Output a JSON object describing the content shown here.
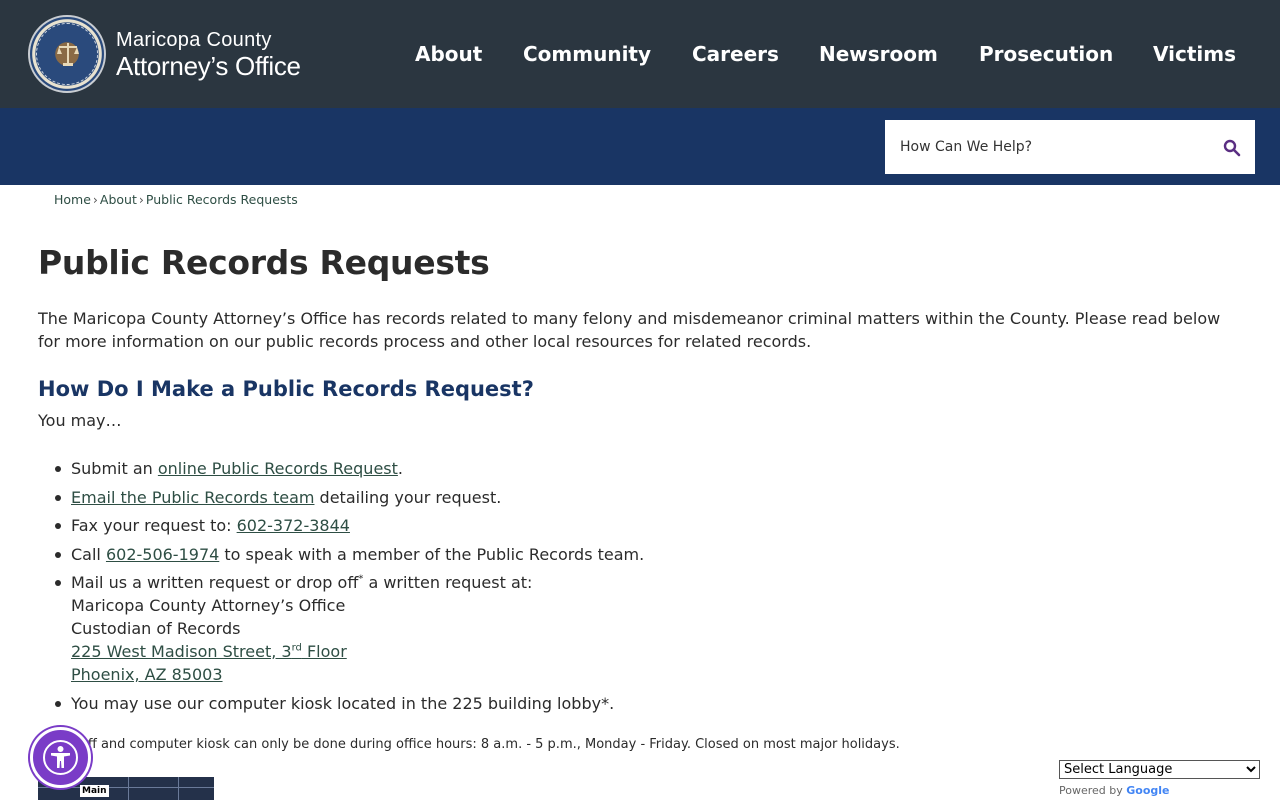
{
  "header": {
    "logo_line1": "Maricopa County",
    "logo_line2": "Attorney’s Office",
    "nav": [
      "About",
      "Community",
      "Careers",
      "Newsroom",
      "Prosecution",
      "Victims"
    ]
  },
  "search": {
    "placeholder": "How Can We Help?"
  },
  "breadcrumb": {
    "home": "Home",
    "about": "About",
    "current": "Public Records Requests",
    "sep": "›"
  },
  "page": {
    "title": "Public Records Requests",
    "intro": "The Maricopa County Attorney’s Office has records related to many felony and misdemeanor criminal matters within the County. Please read below for more information on our public records process and other local resources for related records.",
    "section_title": "How Do I Make a Public Records Request?",
    "you_may": "You may…",
    "steps": {
      "submit_pre": "Submit an ",
      "submit_link": "online Public Records Request",
      "submit_post": ".",
      "email_link": "Email the Public Records team",
      "email_post": " detailing your request.",
      "fax_pre": "Fax your request to: ",
      "fax_link": "602-372-3844",
      "call_pre": "Call ",
      "call_link": "602-506-1974",
      "call_post": " to speak with a member of the Public Records team.",
      "mail_pre": "Mail us a written request or drop off",
      "mail_star": "*",
      "mail_post": " a written request at:",
      "addr1": "Maricopa County Attorney’s Office",
      "addr2": "Custodian of Records",
      "addr3_pre": "225 West Madison Street, 3",
      "addr3_sup": "rd",
      "addr3_post": " Floor",
      "addr4": "Phoenix, AZ 85003",
      "kiosk": "You may use our computer kiosk located in the 225 building lobby*."
    },
    "footnote": "*Drop off and computer kiosk can only be done during office hours: 8 a.m. - 5 p.m., Monday - Friday. Closed on most major holidays.",
    "map_label": "Main"
  },
  "translate": {
    "select_label": "Select Language",
    "powered": "Powered by ",
    "google": "Google"
  },
  "colors": {
    "header": "#2b3640",
    "blue_band": "#193564",
    "heading_blue": "#193564",
    "link": "#2e4e44",
    "accessibility": "#7a3cc7"
  }
}
